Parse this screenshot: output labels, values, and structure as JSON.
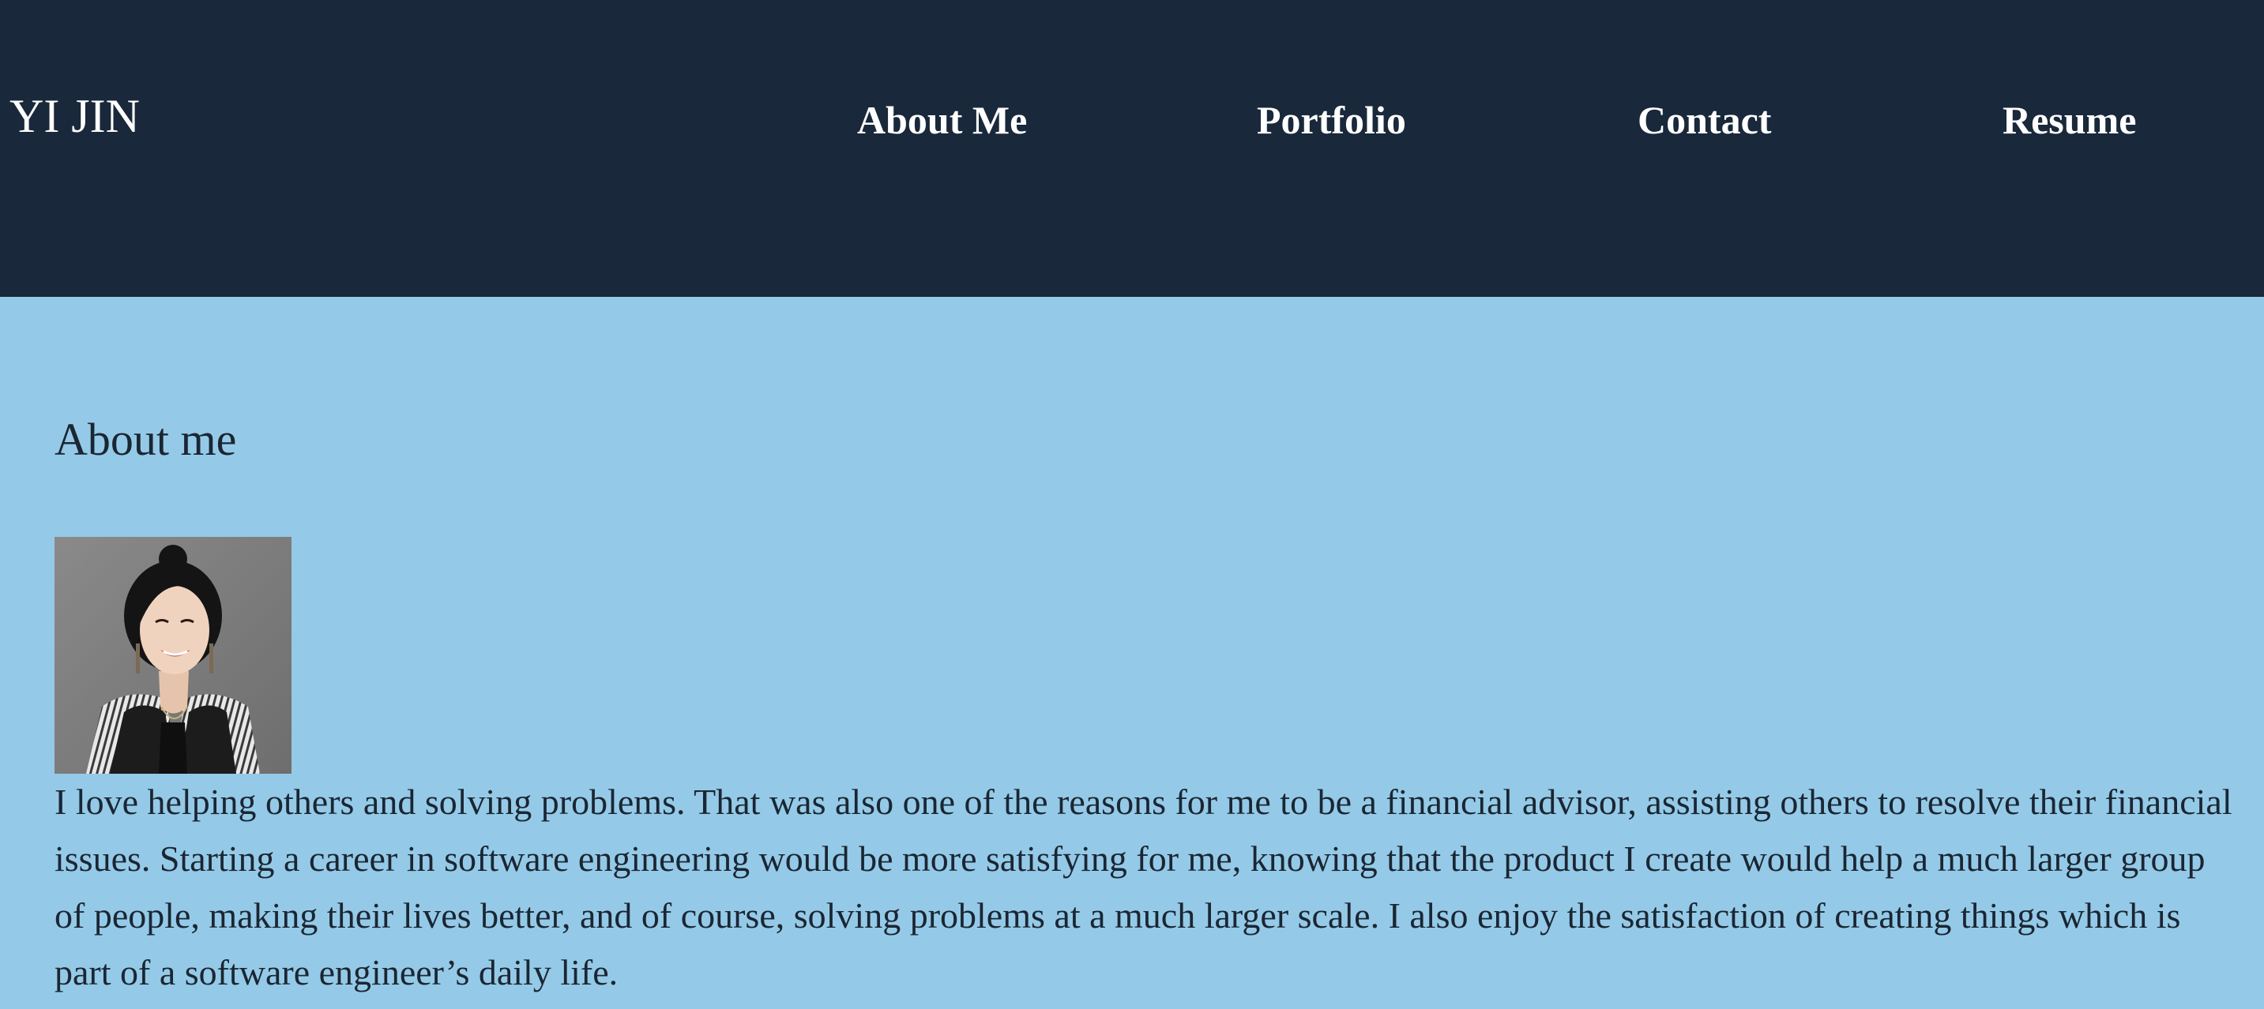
{
  "header": {
    "brand": "YI JIN",
    "nav": [
      {
        "label": "About Me"
      },
      {
        "label": "Portfolio"
      },
      {
        "label": "Contact"
      },
      {
        "label": "Resume"
      }
    ]
  },
  "about": {
    "title": "About me",
    "bio": "I love helping others and solving problems. That was also one of the reasons for me to be a financial advisor, assisting others to resolve their financial issues. Starting a career in software engineering would be more satisfying for me, knowing that the product I create would help a much larger group of people, making their lives better, and of course, solving problems at a much larger scale. I also enjoy the satisfaction of creating things which is part of a software engineer’s daily life."
  },
  "colors": {
    "header_bg": "#19283a",
    "page_bg": "#94cae7",
    "header_text": "#ffffff",
    "body_text": "#1b2633"
  }
}
